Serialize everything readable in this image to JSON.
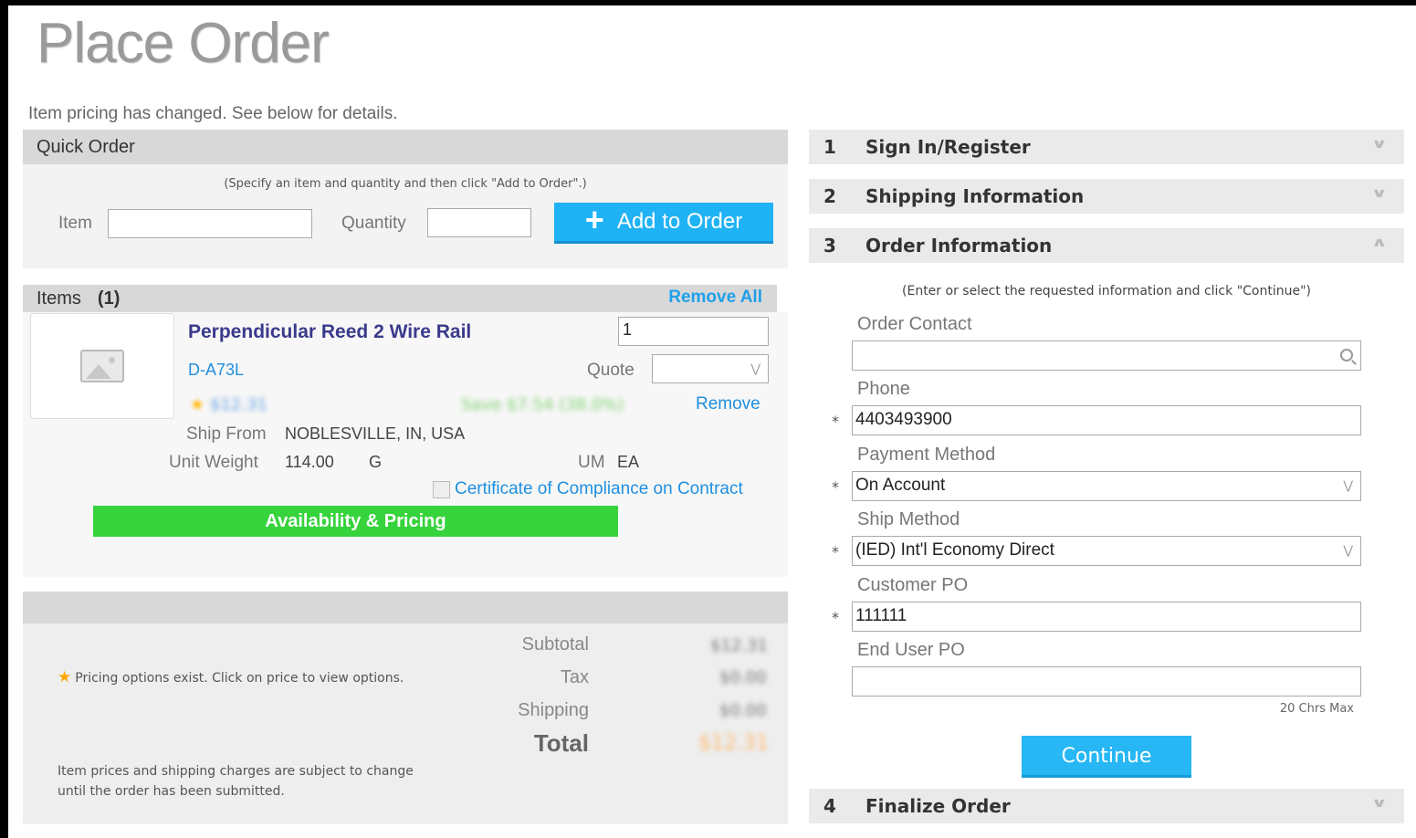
{
  "page": {
    "title": "Place Order",
    "pricing_message": "Item pricing has changed. See below for details."
  },
  "quick_order": {
    "header": "Quick Order",
    "hint": "(Specify an item and quantity and then click \"Add to Order\".)",
    "item_label": "Item",
    "item_value": "",
    "quantity_label": "Quantity",
    "quantity_value": "",
    "add_button": "Add to Order"
  },
  "items": {
    "header": "Items",
    "count": "(1)",
    "remove_all": "Remove All",
    "list": [
      {
        "name": "Perpendicular Reed 2 Wire Rail",
        "sku": "D-A73L",
        "quantity": "1",
        "quote_label": "Quote",
        "quote_value": "",
        "price_blurred": "$12.31",
        "savings_blurred": "Save $7.54 (38.0%)",
        "remove": "Remove",
        "ship_from_label": "Ship From",
        "ship_from": "NOBLESVILLE, IN, USA",
        "unit_weight_label": "Unit Weight",
        "unit_weight": "114.00",
        "unit_weight_unit": "G",
        "um_label": "UM",
        "um": "EA",
        "certificate": "Certificate of Compliance on Contract",
        "availability_button": "Availability & Pricing"
      }
    ]
  },
  "totals": {
    "pricing_options_note": "Pricing options exist. Click on price to view options.",
    "subtotal_label": "Subtotal",
    "subtotal": "$12.31",
    "tax_label": "Tax",
    "tax": "$0.00",
    "shipping_label": "Shipping",
    "shipping": "$0.00",
    "total_label": "Total",
    "total": "$12.31",
    "disclaimer": "Item prices and shipping charges are subject to change until the order has been submitted."
  },
  "checkout": {
    "steps": [
      {
        "num": "1",
        "label": "Sign In/Register",
        "expanded": false
      },
      {
        "num": "2",
        "label": "Shipping Information",
        "expanded": false
      },
      {
        "num": "3",
        "label": "Order Information",
        "expanded": true
      },
      {
        "num": "4",
        "label": "Finalize Order",
        "expanded": false
      }
    ],
    "order_info": {
      "hint": "(Enter or select the requested information and click \"Continue\")",
      "order_contact_label": "Order Contact",
      "order_contact": "",
      "phone_label": "Phone",
      "phone": "4403493900",
      "payment_method_label": "Payment Method",
      "payment_method": "On Account",
      "ship_method_label": "Ship Method",
      "ship_method": "(IED) Int'l Economy Direct",
      "customer_po_label": "Customer PO",
      "customer_po": "111111",
      "end_user_po_label": "End User PO",
      "end_user_po": "",
      "max_note": "20 Chrs Max",
      "required_mark": "*",
      "continue_button": "Continue"
    }
  },
  "colors": {
    "accent_blue": "#1fb2f5",
    "availability_green": "#37d33c",
    "product_name": "#3a3a8c",
    "link_blue": "#1f8fe0"
  }
}
